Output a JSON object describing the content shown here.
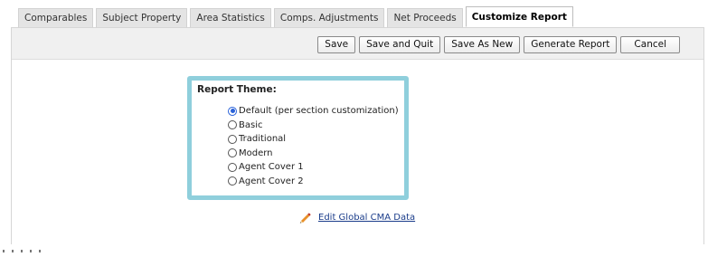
{
  "tabs": [
    {
      "label": "Comparables",
      "active": false
    },
    {
      "label": "Subject Property",
      "active": false
    },
    {
      "label": "Area Statistics",
      "active": false
    },
    {
      "label": "Comps. Adjustments",
      "active": false
    },
    {
      "label": "Net Proceeds",
      "active": false
    },
    {
      "label": "Customize Report",
      "active": true
    }
  ],
  "toolbar": {
    "save_label": "Save",
    "save_quit_label": "Save and Quit",
    "save_as_new_label": "Save As New",
    "generate_label": "Generate Report",
    "cancel_label": "Cancel"
  },
  "theme": {
    "title": "Report Theme:",
    "options": [
      {
        "label": "Default (per section customization)",
        "checked": true
      },
      {
        "label": "Basic",
        "checked": false
      },
      {
        "label": "Traditional",
        "checked": false
      },
      {
        "label": "Modern",
        "checked": false
      },
      {
        "label": "Agent Cover 1",
        "checked": false
      },
      {
        "label": "Agent Cover 2",
        "checked": false
      }
    ]
  },
  "edit_link": {
    "label": "Edit Global CMA Data",
    "icon": "pencil-icon"
  },
  "colors": {
    "theme_border": "#8fcfdc",
    "link": "#1a3c8a",
    "pencil": "#e8902a",
    "radio_selected": "#2a62d9"
  }
}
